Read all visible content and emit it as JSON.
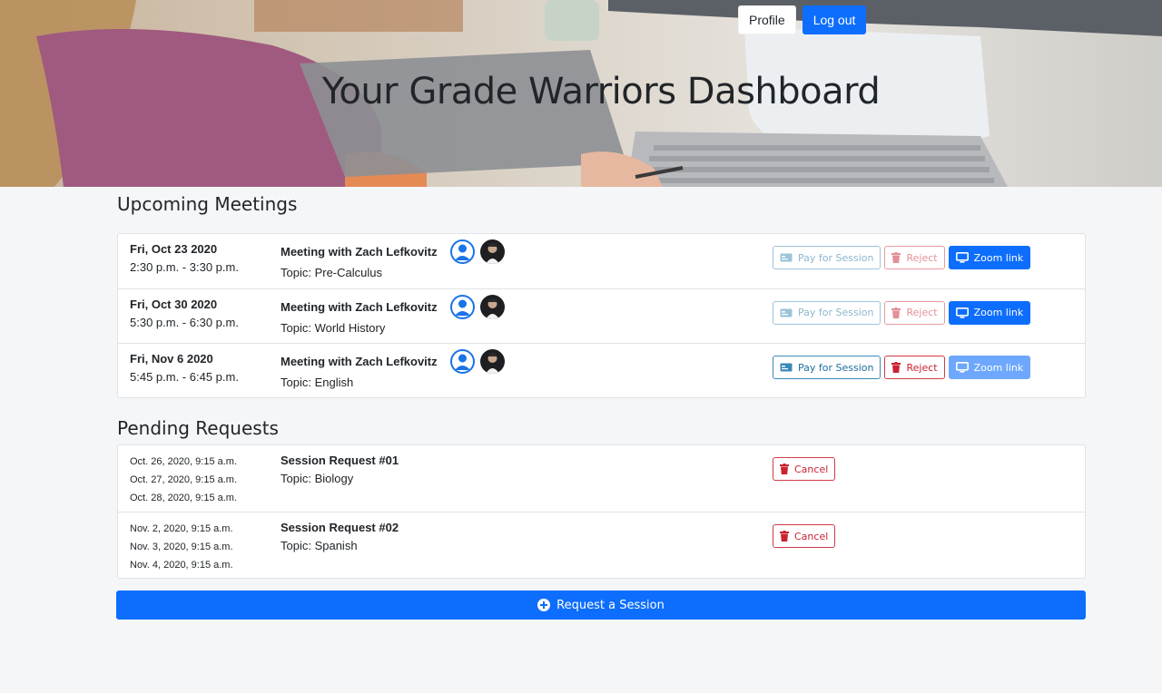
{
  "header": {
    "profile_label": "Profile",
    "logout_label": "Log out",
    "title": "Your Grade Warriors Dashboard"
  },
  "upcoming": {
    "heading": "Upcoming Meetings",
    "meetings": [
      {
        "date": "Fri, Oct 23 2020",
        "time": "2:30 p.m. - 3:30 p.m.",
        "title": "Meeting with Zach Lefkovitz",
        "topic": "Topic: Pre-Calculus",
        "pay_label": "Pay for Session",
        "reject_label": "Reject",
        "zoom_label": "Zoom link"
      },
      {
        "date": "Fri, Oct 30 2020",
        "time": "5:30 p.m. - 6:30 p.m.",
        "title": "Meeting with Zach Lefkovitz",
        "topic": "Topic: World History",
        "pay_label": "Pay for Session",
        "reject_label": "Reject",
        "zoom_label": "Zoom link"
      },
      {
        "date": "Fri, Nov 6 2020",
        "time": "5:45 p.m. - 6:45 p.m.",
        "title": "Meeting with Zach Lefkovitz",
        "topic": "Topic: English",
        "pay_label": "Pay for Session",
        "reject_label": "Reject",
        "zoom_label": "Zoom link"
      }
    ]
  },
  "pending": {
    "heading": "Pending Requests",
    "requests": [
      {
        "dates": [
          "Oct. 26, 2020, 9:15 a.m.",
          "Oct. 27, 2020, 9:15 a.m.",
          "Oct. 28, 2020, 9:15 a.m."
        ],
        "title": "Session Request #01",
        "topic": "Topic: Biology",
        "cancel_label": "Cancel"
      },
      {
        "dates": [
          "Nov. 2, 2020, 9:15 a.m.",
          "Nov. 3, 2020, 9:15 a.m.",
          "Nov. 4, 2020, 9:15 a.m."
        ],
        "title": "Session Request #02",
        "topic": "Topic: Spanish",
        "cancel_label": "Cancel"
      }
    ]
  },
  "request_button_label": "Request a Session",
  "colors": {
    "primary": "#0d6efd",
    "danger": "#c82333",
    "info": "#1e6f9f",
    "background": "#f5f6f8"
  },
  "icons": {
    "pay": "credit-card-icon",
    "reject": "trash-icon",
    "zoom": "monitor-icon",
    "cancel": "trash-icon",
    "request": "plus-circle-icon"
  }
}
